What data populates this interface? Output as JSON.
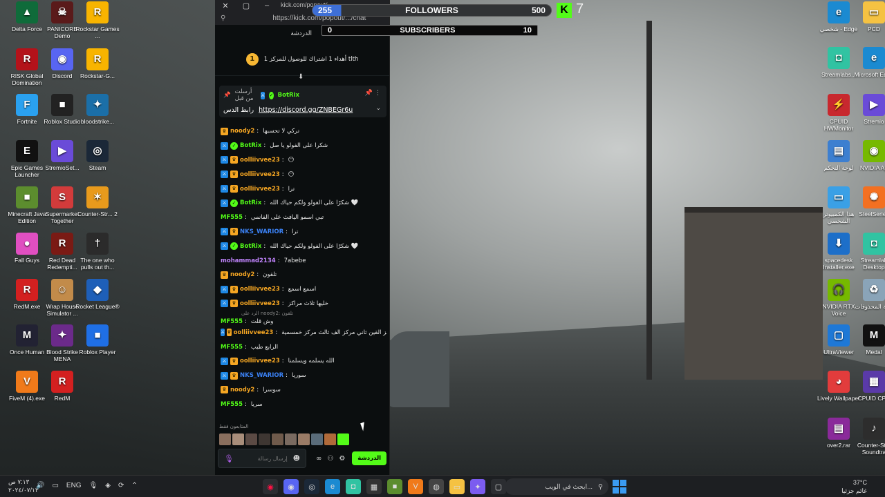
{
  "desktop_left_icons": [
    {
      "label": "Delta Force",
      "icon": "delta-force-icon",
      "color": "#0f6b3a",
      "glyph": "▲"
    },
    {
      "label": "PANICORE Demo",
      "icon": "panicore-icon",
      "color": "#5a1a1a",
      "glyph": "☠"
    },
    {
      "label": "Rockstar Games ...",
      "icon": "rockstar-icon",
      "color": "#f8b400",
      "glyph": "R"
    },
    {
      "label": "RISK Global Domination",
      "icon": "risk-icon",
      "color": "#b3121a",
      "glyph": "R"
    },
    {
      "label": "Discord",
      "icon": "discord-icon",
      "color": "#5865f2",
      "glyph": "◉"
    },
    {
      "label": "Rockstar-G...",
      "icon": "rockstar-icon",
      "color": "#f8b400",
      "glyph": "R"
    },
    {
      "label": "Fortnite",
      "icon": "fortnite-icon",
      "color": "#2aa1f0",
      "glyph": "F"
    },
    {
      "label": "Roblox Studio",
      "icon": "roblox-studio-icon",
      "color": "#222",
      "glyph": "■"
    },
    {
      "label": "bloodstrike...",
      "icon": "bloodstrike-icon",
      "color": "#1b6fa8",
      "glyph": "✦"
    },
    {
      "label": "Epic Games Launcher",
      "icon": "epic-games-icon",
      "color": "#111",
      "glyph": "E"
    },
    {
      "label": "StremioSet...",
      "icon": "stremio-icon",
      "color": "#6a4bd8",
      "glyph": "▶"
    },
    {
      "label": "Steam",
      "icon": "steam-icon",
      "color": "#1b2838",
      "glyph": "◎"
    },
    {
      "label": "Minecraft Java Edition",
      "icon": "minecraft-icon",
      "color": "#5c8d2e",
      "glyph": "■"
    },
    {
      "label": "Supermarket Together",
      "icon": "supermarket-icon",
      "color": "#d23b3b",
      "glyph": "S"
    },
    {
      "label": "Counter-Str... 2",
      "icon": "counter-strike-icon",
      "color": "#e89a1c",
      "glyph": "✶"
    },
    {
      "label": "Fall Guys",
      "icon": "fall-guys-icon",
      "color": "#e04fc1",
      "glyph": "●"
    },
    {
      "label": "Red Dead Redempti...",
      "icon": "red-dead-icon",
      "color": "#7a1a14",
      "glyph": "R"
    },
    {
      "label": "The one who pulls out th...",
      "icon": "the-one-who-icon",
      "color": "#2b2b2b",
      "glyph": "†"
    },
    {
      "label": "RedM.exe",
      "icon": "redm-icon",
      "color": "#d32020",
      "glyph": "R"
    },
    {
      "label": "Wrap House Simulator ...",
      "icon": "wrap-house-icon",
      "color": "#c28b4a",
      "glyph": "☺"
    },
    {
      "label": "Rocket League®",
      "icon": "rocket-league-icon",
      "color": "#1e5fb8",
      "glyph": "◆"
    },
    {
      "label": "Once Human",
      "icon": "once-human-icon",
      "color": "#223",
      "glyph": "M"
    },
    {
      "label": "Blood Strike MENA",
      "icon": "blood-strike-icon",
      "color": "#6b2a8a",
      "glyph": "✦"
    },
    {
      "label": "Roblox Player",
      "icon": "roblox-player-icon",
      "color": "#1f6fe5",
      "glyph": "■"
    },
    {
      "label": "FiveM (4).exe",
      "icon": "fivem-icon",
      "color": "#f07a1a",
      "glyph": "V"
    },
    {
      "label": "RedM",
      "icon": "redm-icon",
      "color": "#d32020",
      "glyph": "R"
    }
  ],
  "desktop_right_icons": [
    {
      "label": "شخصي - Edge",
      "icon": "edge-icon",
      "color": "#1b8ad1",
      "glyph": "e"
    },
    {
      "label": "PCD",
      "icon": "folder-icon",
      "color": "#f5c242",
      "glyph": "▭"
    },
    {
      "label": "Streamlabs...",
      "icon": "streamlabs-icon",
      "color": "#31c3a2",
      "glyph": "◘"
    },
    {
      "label": "Microsoft Edge",
      "icon": "edge-icon",
      "color": "#1b8ad1",
      "glyph": "e"
    },
    {
      "label": "CPUID HWMonitor",
      "icon": "hwmonitor-icon",
      "color": "#c8282e",
      "glyph": "⚡"
    },
    {
      "label": "Stremio",
      "icon": "stremio-icon",
      "color": "#6a4bd8",
      "glyph": "▶"
    },
    {
      "label": "لوحة التحكم",
      "icon": "control-panel-icon",
      "color": "#3d7fd0",
      "glyph": "▤"
    },
    {
      "label": "NVIDIA Ap",
      "icon": "nvidia-icon",
      "color": "#76b900",
      "glyph": "◉"
    },
    {
      "label": "هذا الكمبيوتر الشخصي",
      "icon": "this-pc-icon",
      "color": "#3aa0e6",
      "glyph": "▭"
    },
    {
      "label": "SteelSeries",
      "icon": "steelseries-icon",
      "color": "#f37021",
      "glyph": "✺"
    },
    {
      "label": "spacedesk Installer.exe",
      "icon": "spacedesk-icon",
      "color": "#1d6fc9",
      "glyph": "⬇"
    },
    {
      "label": "Streamlab Desktop",
      "icon": "streamlabs-icon",
      "color": "#31c3a2",
      "glyph": "◘"
    },
    {
      "label": "NVIDIA RTX Voice",
      "icon": "rtx-voice-icon",
      "color": "#76b900",
      "glyph": "🎧"
    },
    {
      "label": "سلة المحذوفات",
      "icon": "recycle-bin-icon",
      "color": "#8aa4b8",
      "glyph": "♻"
    },
    {
      "label": "UltraViewer",
      "icon": "ultraviewer-icon",
      "color": "#1e78d6",
      "glyph": "▢"
    },
    {
      "label": "Medal",
      "icon": "medal-icon",
      "color": "#111",
      "glyph": "M"
    },
    {
      "label": "Lively Wallpaper",
      "icon": "lively-icon",
      "color": "#e23c3c",
      "glyph": "◕"
    },
    {
      "label": "CPUID CPU",
      "icon": "cpuz-icon",
      "color": "#5a3aa8",
      "glyph": "▦"
    },
    {
      "label": "over2.rar",
      "icon": "rar-archive-icon",
      "color": "#8a2a9a",
      "glyph": "▤"
    },
    {
      "label": "Counter-St 2 Soundtra",
      "icon": "music-icon",
      "color": "#2d2d2d",
      "glyph": "♪"
    }
  ],
  "browser": {
    "title_url": "kick.com/popout/...",
    "address_url": "https://kick.com/popout/.../chat",
    "chat_tab": "الدردشة",
    "gift_banner": "أهداء 1 اشتراك للوصول للمركز 1 tlth",
    "gift_rank": "1",
    "pinned": {
      "sent_by_label": "أرسلت من قبل",
      "user": "BotRix",
      "link_label": "رابط الدس",
      "link": "https://discord.gg/ZNBEGr6u"
    },
    "messages": [
      {
        "user": "noody2",
        "color": "#f5a623",
        "badges": [
          "vip"
        ],
        "text": "تركي لا تحسبها"
      },
      {
        "user": "BotRix",
        "color": "#53fc18",
        "badges": [
          "mod",
          "bot"
        ],
        "text": "شكرا على الفولو يا صل"
      },
      {
        "user": "oolliivvee23",
        "color": "#f5a623",
        "badges": [
          "mod",
          "vip"
        ],
        "text": "😶"
      },
      {
        "user": "oolliivvee23",
        "color": "#f5a623",
        "badges": [
          "mod",
          "vip"
        ],
        "text": "😶"
      },
      {
        "user": "oolliivvee23",
        "color": "#f5a623",
        "badges": [
          "mod",
          "vip"
        ],
        "text": "ترا"
      },
      {
        "user": "BotRix",
        "color": "#53fc18",
        "badges": [
          "mod",
          "bot"
        ],
        "text": "شكرًا على الفولو ولكم حياك الله 🤍"
      },
      {
        "user": "MF555",
        "color": "#53fc18",
        "badges": [],
        "text": "تبي اسمو اليافث على الفانمي"
      },
      {
        "user": "NKS_WARIOR",
        "color": "#3b82f6",
        "badges": [
          "mod",
          "vip"
        ],
        "text": "ترا"
      },
      {
        "user": "BotRix",
        "color": "#53fc18",
        "badges": [
          "mod",
          "bot"
        ],
        "text": "شكرًا على الفولو ولكم حياك الله 🤍"
      },
      {
        "user": "mohammad2134",
        "color": "#c084fc",
        "badges": [],
        "text": "7abebe"
      },
      {
        "user": "noody2",
        "color": "#f5a623",
        "badges": [
          "vip"
        ],
        "text": "تلقون"
      },
      {
        "user": "oolliivvee23",
        "color": "#f5a623",
        "badges": [
          "mod",
          "vip"
        ],
        "text": "اسمع اسمع"
      },
      {
        "user": "oolliivvee23",
        "color": "#f5a623",
        "badges": [
          "mod",
          "vip"
        ],
        "text": "خليها ثلاث مراكز"
      },
      {
        "user": "MF555",
        "color": "#53fc18",
        "badges": [],
        "text": "وش قلت",
        "reply": "الرد على noody2: تلقون"
      },
      {
        "user": "oolliivvee23",
        "color": "#f5a623",
        "badges": [
          "mod",
          "vip"
        ],
        "text": "اول مركز القين ثاني مركز الف ثالث مركز خمسمية"
      },
      {
        "user": "MF555",
        "color": "#53fc18",
        "badges": [],
        "text": "الرابع طيب"
      },
      {
        "user": "oolliivvee23",
        "color": "#f5a623",
        "badges": [
          "mod",
          "vip"
        ],
        "text": "الله يسلمه ويسلمنا"
      },
      {
        "user": "NKS_WARIOR",
        "color": "#3b82f6",
        "badges": [
          "mod",
          "vip"
        ],
        "text": "سوريا"
      },
      {
        "user": "noody2",
        "color": "#f5a623",
        "badges": [
          "vip"
        ],
        "text": "سوسرا"
      },
      {
        "user": "MF555",
        "color": "#53fc18",
        "badges": [],
        "text": "سريا"
      }
    ],
    "viewers_label": "المتابعون فقط",
    "input_placeholder": "إرسال رسالة",
    "chat_button": "الدردشة"
  },
  "overlay": {
    "followers_label": "FOLLOWERS",
    "followers_current": "255",
    "followers_goal": "500",
    "subscribers_label": "SUBSCRIBERS",
    "subscribers_current": "0",
    "subscribers_goal": "10",
    "kick_count": "7"
  },
  "taskbar": {
    "time": "٧:١٣ ص",
    "date": "٢٠٢٤/٠٧/١٣",
    "language": "ENG",
    "search_placeholder": "ابحث في الويب...",
    "weather_temp": "37°C",
    "weather_label": "غائم جزئيا"
  },
  "colors": {
    "kick_green": "#53fc18",
    "chat_bg": "#0b0e0f",
    "taskbar_bg": "#1d1f22"
  }
}
